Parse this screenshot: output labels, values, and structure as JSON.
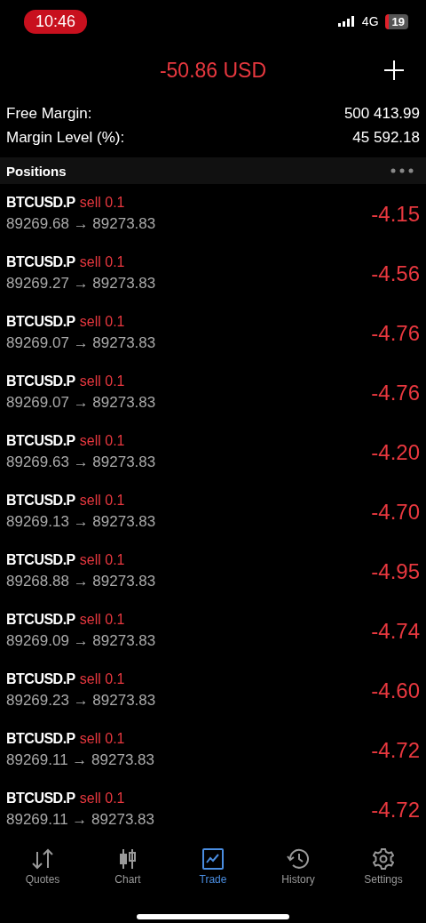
{
  "status_bar": {
    "time": "10:46",
    "network": "4G",
    "battery": "19"
  },
  "header": {
    "title": "-50.86 USD"
  },
  "summary": [
    {
      "label": "Free Margin:",
      "value": "500 413.99"
    },
    {
      "label": "Margin Level (%):",
      "value": "45 592.18"
    }
  ],
  "positions_header": {
    "title": "Positions"
  },
  "positions": [
    {
      "symbol": "BTCUSD.P",
      "order": "sell 0.1",
      "prices": "89269.68 → 89273.83",
      "profit": "-4.15"
    },
    {
      "symbol": "BTCUSD.P",
      "order": "sell 0.1",
      "prices": "89269.27 → 89273.83",
      "profit": "-4.56"
    },
    {
      "symbol": "BTCUSD.P",
      "order": "sell 0.1",
      "prices": "89269.07 → 89273.83",
      "profit": "-4.76"
    },
    {
      "symbol": "BTCUSD.P",
      "order": "sell 0.1",
      "prices": "89269.07 → 89273.83",
      "profit": "-4.76"
    },
    {
      "symbol": "BTCUSD.P",
      "order": "sell 0.1",
      "prices": "89269.63 → 89273.83",
      "profit": "-4.20"
    },
    {
      "symbol": "BTCUSD.P",
      "order": "sell 0.1",
      "prices": "89269.13 → 89273.83",
      "profit": "-4.70"
    },
    {
      "symbol": "BTCUSD.P",
      "order": "sell 0.1",
      "prices": "89268.88 → 89273.83",
      "profit": "-4.95"
    },
    {
      "symbol": "BTCUSD.P",
      "order": "sell 0.1",
      "prices": "89269.09 → 89273.83",
      "profit": "-4.74"
    },
    {
      "symbol": "BTCUSD.P",
      "order": "sell 0.1",
      "prices": "89269.23 → 89273.83",
      "profit": "-4.60"
    },
    {
      "symbol": "BTCUSD.P",
      "order": "sell 0.1",
      "prices": "89269.11 → 89273.83",
      "profit": "-4.72"
    },
    {
      "symbol": "BTCUSD.P",
      "order": "sell 0.1",
      "prices": "89269.11 → 89273.83",
      "profit": "-4.72"
    }
  ],
  "tab_bar": [
    {
      "kind": "quotes",
      "label": "Quotes",
      "selected": false
    },
    {
      "kind": "chart",
      "label": "Chart",
      "selected": false
    },
    {
      "kind": "trade",
      "label": "Trade",
      "selected": true
    },
    {
      "kind": "history",
      "label": "History",
      "selected": false
    },
    {
      "kind": "settings",
      "label": "Settings",
      "selected": false
    }
  ]
}
